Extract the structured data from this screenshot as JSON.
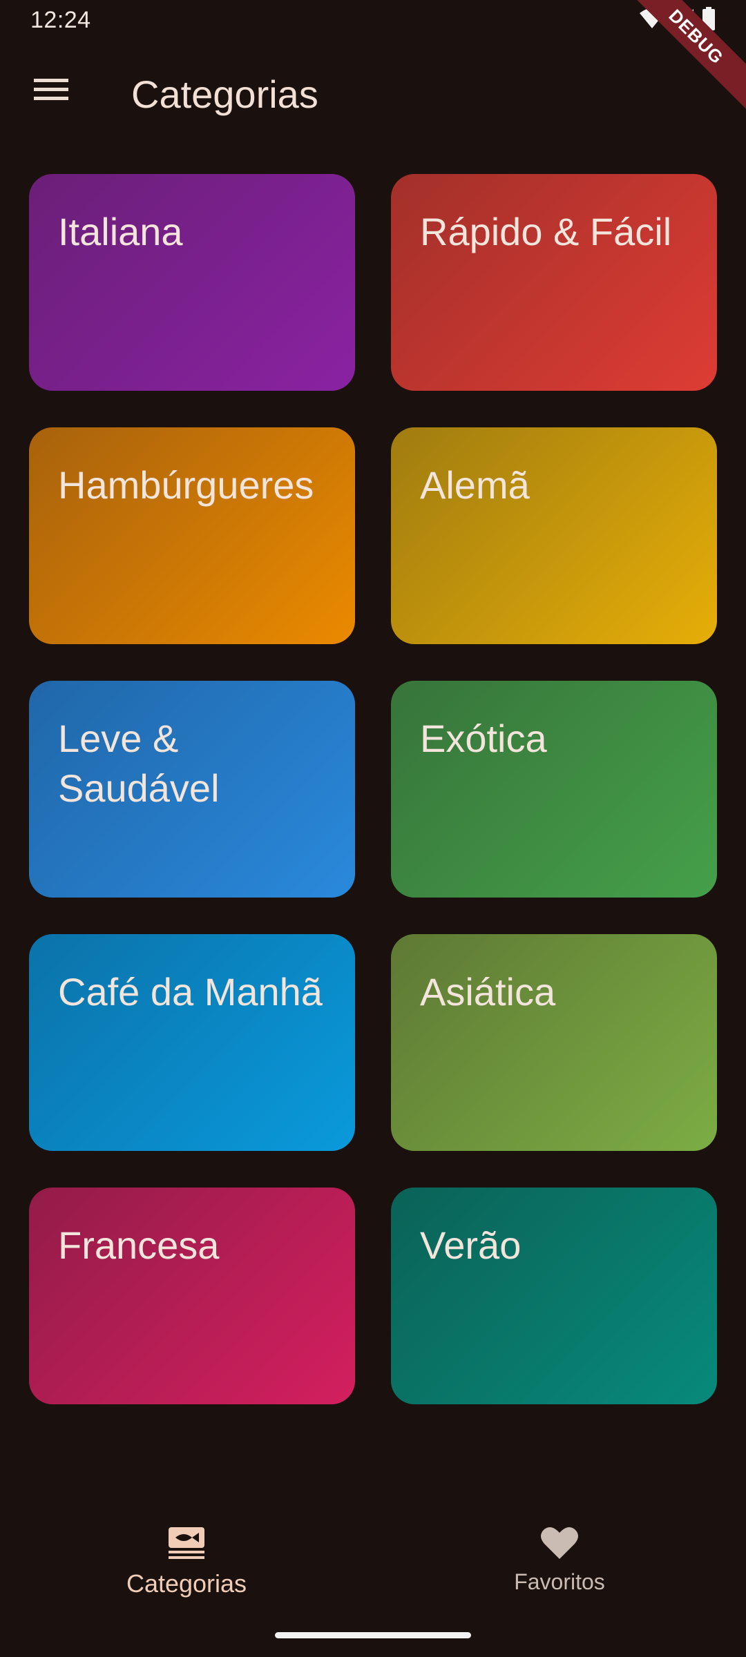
{
  "status_bar": {
    "time": "12:24",
    "icons": [
      "wifi-icon",
      "signal-icon",
      "battery-icon"
    ]
  },
  "debug_banner": "DEBUG",
  "app_bar": {
    "menu_icon": "menu-icon",
    "title": "Categorias"
  },
  "categories": [
    {
      "label": "Italiana",
      "color_from": "#6a1f78",
      "color_to": "#8a22a2"
    },
    {
      "label": "Rápido & Fácil",
      "color_from": "#a3302a",
      "color_to": "#dd3c34"
    },
    {
      "label": "Hambúrgueres",
      "color_from": "#a8620c",
      "color_to": "#ea8a00"
    },
    {
      "label": "Alemã",
      "color_from": "#a07c10",
      "color_to": "#e6ae08"
    },
    {
      "label": "Leve & Saudável",
      "color_from": "#2067a9",
      "color_to": "#2a89dc"
    },
    {
      "label": "Exótica",
      "color_from": "#37743a",
      "color_to": "#45a04a"
    },
    {
      "label": "Café da Manhã",
      "color_from": "#0b72a9",
      "color_to": "#0a9adc"
    },
    {
      "label": "Asiática",
      "color_from": "#5e7934",
      "color_to": "#7cad44"
    },
    {
      "label": "Francesa",
      "color_from": "#931c48",
      "color_to": "#d41f5f"
    },
    {
      "label": "Verão",
      "color_from": "#0b6257",
      "color_to": "#078a7a"
    }
  ],
  "bottom_nav": {
    "items": [
      {
        "label": "Categorias",
        "icon": "set-meal-icon",
        "selected": true
      },
      {
        "label": "Favoritos",
        "icon": "heart-icon",
        "selected": false
      }
    ]
  }
}
